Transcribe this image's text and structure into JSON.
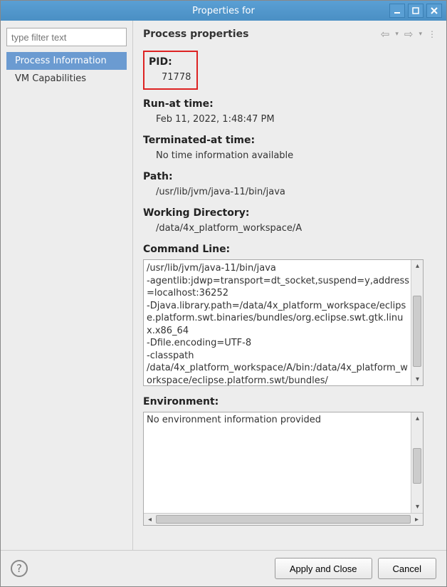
{
  "window": {
    "title": "Properties for"
  },
  "sidebar": {
    "filter_placeholder": "type filter text",
    "items": [
      {
        "label": "Process Information",
        "selected": true
      },
      {
        "label": "VM Capabilities",
        "selected": false
      }
    ]
  },
  "panel": {
    "title": "Process properties"
  },
  "fields": {
    "pid": {
      "label": "PID:",
      "value": "71778"
    },
    "runat": {
      "label": "Run-at time:",
      "value": "Feb 11, 2022, 1:48:47 PM"
    },
    "termat": {
      "label": "Terminated-at time:",
      "value": "No time information available"
    },
    "path": {
      "label": "Path:",
      "value": "/usr/lib/jvm/java-11/bin/java"
    },
    "workdir": {
      "label": "Working Directory:",
      "value": "/data/4x_platform_workspace/A"
    },
    "cmdline": {
      "label": "Command Line:",
      "lines": [
        "/usr/lib/jvm/java-11/bin/java",
        "-agentlib:jdwp=transport=dt_socket,suspend=y,address=localhost:36252",
        "-Djava.library.path=/data/4x_platform_workspace/eclipse.platform.swt.binaries/bundles/org.eclipse.swt.gtk.linux.x86_64",
        "-Dfile.encoding=UTF-8",
        "-classpath",
        "/data/4x_platform_workspace/A/bin:/data/4x_platform_workspace/eclipse.platform.swt/bundles/"
      ]
    },
    "env": {
      "label": "Environment:",
      "value": "No environment information provided"
    }
  },
  "footer": {
    "apply_label": "Apply and Close",
    "cancel_label": "Cancel"
  }
}
